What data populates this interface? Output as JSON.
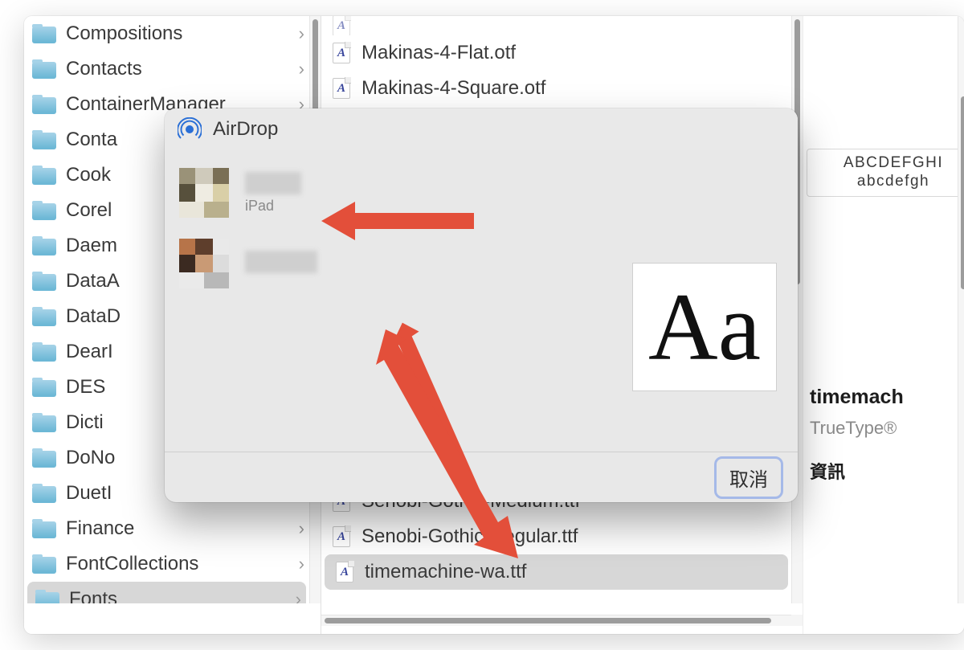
{
  "sidebar": {
    "items": [
      {
        "label": "Compositions"
      },
      {
        "label": "Contacts"
      },
      {
        "label": "ContainerManager"
      },
      {
        "label": "Conta"
      },
      {
        "label": "Cook"
      },
      {
        "label": "Corel"
      },
      {
        "label": "Daem"
      },
      {
        "label": "DataA"
      },
      {
        "label": "DataD"
      },
      {
        "label": "DearI"
      },
      {
        "label": "DES"
      },
      {
        "label": "Dicti"
      },
      {
        "label": "DoNo"
      },
      {
        "label": "DuetI"
      },
      {
        "label": "Finance"
      },
      {
        "label": "FontCollections"
      },
      {
        "label": "Fonts"
      }
    ],
    "selectedIndex": 16
  },
  "files": {
    "items": [
      {
        "name": "Makinas-4-Flat.otf"
      },
      {
        "name": "Makinas-4-Square.otf"
      },
      {
        "name": "Senobi-Gothic-Medium.ttf"
      },
      {
        "name": "Senobi-Gothic-Regular.ttf"
      },
      {
        "name": "timemachine-wa.ttf"
      }
    ],
    "selectedIndex": 4
  },
  "info": {
    "sample_upper": "ABCDEFGHI",
    "sample_lower": "abcdefgh",
    "title": "timemach",
    "subtitle": "TrueType®",
    "section": "資訊"
  },
  "airdrop": {
    "title": "AirDrop",
    "devices": [
      {
        "label": "iPad"
      },
      {
        "label": ""
      }
    ],
    "preview_glyphs": "Aa",
    "cancel_label": "取消"
  }
}
